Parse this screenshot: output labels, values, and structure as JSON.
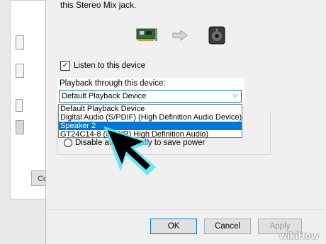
{
  "dialog": {
    "top_text": "this Stereo Mix jack.",
    "listen_checkbox": {
      "checked": true,
      "label": "Listen to this device"
    },
    "playback": {
      "label": "Playback through this device:",
      "selected": "Default Playback Device",
      "options": [
        "Default Playback Device",
        "Digital Audio (S/PDIF) (High Definition Audio Device)",
        "Speaker 2",
        "GT24C14-8 (Intel(R) High Definition Audio)"
      ],
      "highlighted_index": 2
    },
    "power_option": "Disable automatically to save power",
    "buttons": {
      "ok": "OK",
      "cancel": "Cancel",
      "apply": "Apply"
    }
  },
  "background_window": {
    "button_label": "Co"
  },
  "watermark": "wikiHow",
  "colors": {
    "selection": "#0078d7",
    "cursor_glow": "#4fe6f2"
  }
}
